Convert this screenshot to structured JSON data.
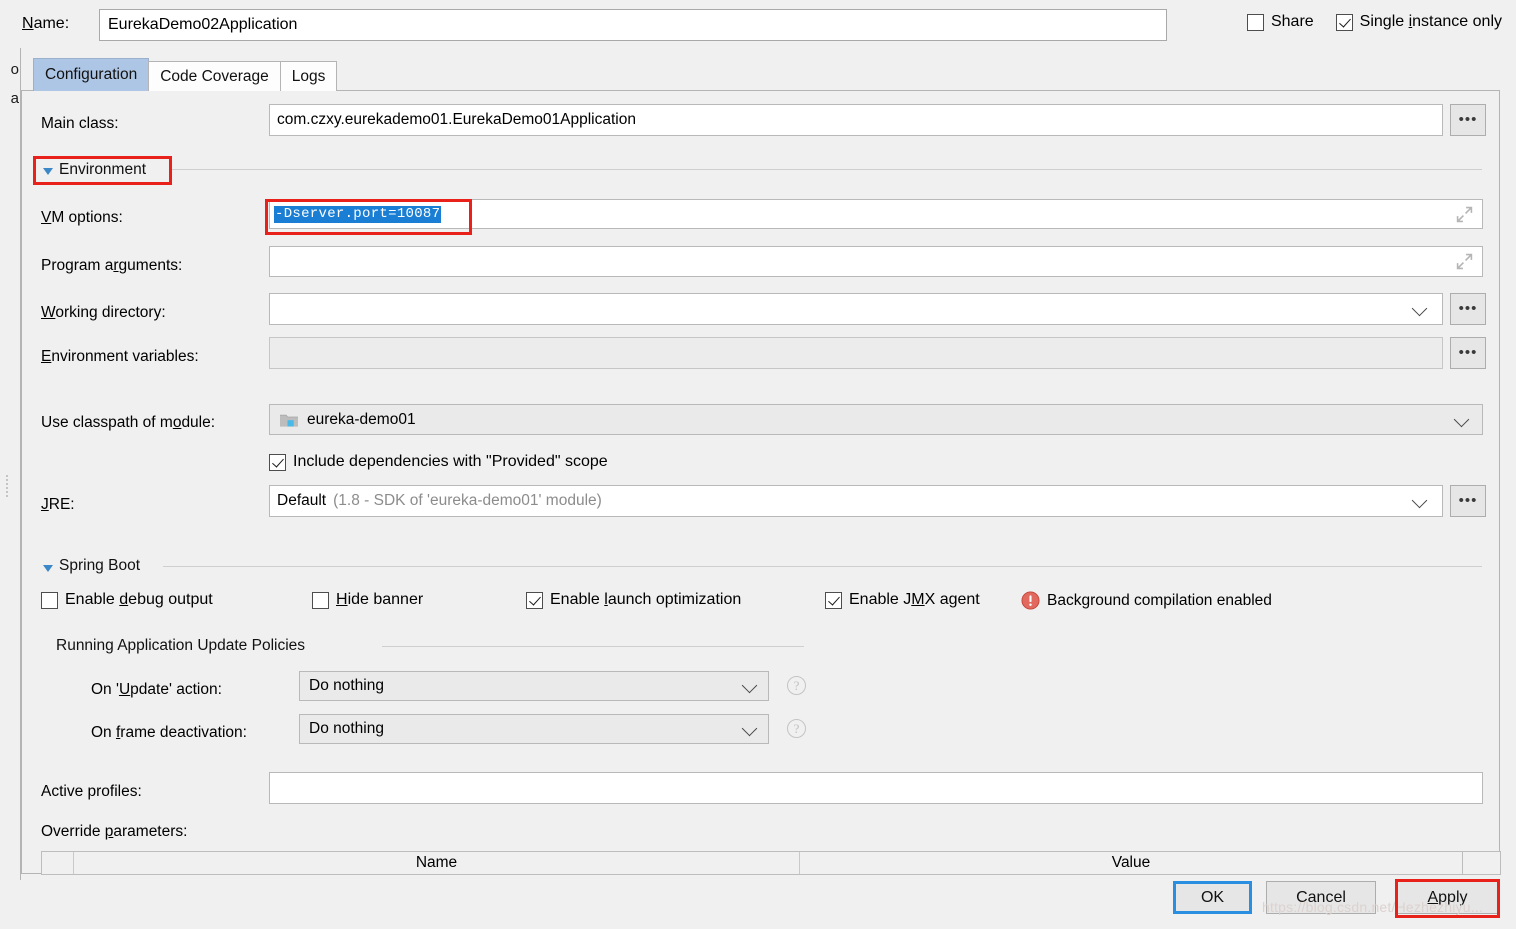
{
  "window": {
    "name_label": "Name:",
    "name_value": "EurekaDemo02Application",
    "share_label": "Share",
    "single_instance_label": "Single instance only",
    "share_checked": false,
    "single_instance_checked": true
  },
  "tabs": [
    {
      "label": "Configuration",
      "active": true
    },
    {
      "label": "Code Coverage",
      "active": false
    },
    {
      "label": "Logs",
      "active": false
    }
  ],
  "left_strip": {
    "clipped_lines": [
      "o",
      "a"
    ]
  },
  "form": {
    "main_class": {
      "label": "Main class:",
      "value": "com.czxy.eurekademo01.EurekaDemo01Application",
      "browse": "..."
    },
    "environment_section": {
      "title": "Environment",
      "expanded": true
    },
    "vm_options": {
      "label": "VM options:",
      "value": "-Dserver.port=10087",
      "selected": true,
      "expand_icon": "expand-icon"
    },
    "program_arguments": {
      "label": "Program arguments:",
      "value": "",
      "expand_icon": "expand-icon"
    },
    "working_directory": {
      "label": "Working directory:",
      "value": "",
      "browse": "..."
    },
    "environment_variables": {
      "label": "Environment variables:",
      "value": "",
      "browse": "...",
      "disabled": true
    },
    "use_classpath": {
      "label": "Use classpath of module:",
      "value": "eureka-demo01",
      "icon": "module-icon"
    },
    "include_provided": {
      "label": "Include dependencies with \"Provided\" scope",
      "checked": true
    },
    "jre": {
      "label": "JRE:",
      "value": "Default",
      "hint": "(1.8 - SDK of 'eureka-demo01' module)",
      "browse": "..."
    }
  },
  "spring_boot": {
    "title": "Spring Boot",
    "expanded": true,
    "checkboxes": [
      {
        "label": "Enable debug output",
        "checked": false
      },
      {
        "label": "Hide banner",
        "checked": false
      },
      {
        "label": "Enable launch optimization",
        "checked": true
      },
      {
        "label": "Enable JMX agent",
        "checked": true
      }
    ],
    "background_compilation": {
      "label": "Background compilation enabled",
      "icon": "warning-icon"
    },
    "update_policies": {
      "title": "Running Application Update Policies",
      "rows": [
        {
          "label": "On 'Update' action:",
          "value": "Do nothing",
          "help": "?"
        },
        {
          "label": "On frame deactivation:",
          "value": "Do nothing",
          "help": "?"
        }
      ]
    },
    "active_profiles": {
      "label": "Active profiles:",
      "value": ""
    },
    "override_parameters": {
      "label": "Override parameters:",
      "columns": [
        "Name",
        "Value"
      ]
    }
  },
  "buttons": {
    "ok": "OK",
    "cancel": "Cancel",
    "apply": "Apply"
  },
  "watermark": "https://blog.csdn.net/Hezhezhiyu..."
}
